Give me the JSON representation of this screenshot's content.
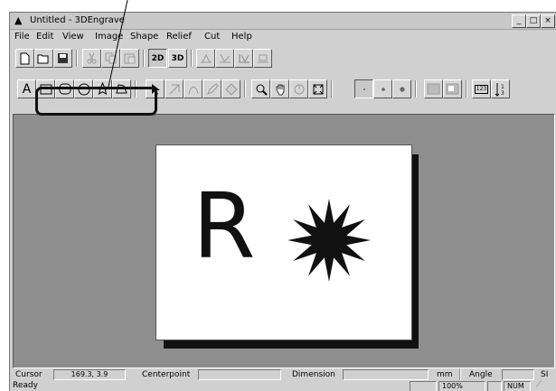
{
  "window": {
    "title": "Untitled - 3DEngrave",
    "minimize": "_",
    "maximize": "□",
    "close": "×"
  },
  "menu": [
    {
      "label": "File"
    },
    {
      "label": "Edit"
    },
    {
      "label": "View"
    },
    {
      "label": "Image"
    },
    {
      "label": "Shape"
    },
    {
      "label": "Relief"
    },
    {
      "label": "Cut"
    },
    {
      "label": "Help"
    }
  ],
  "toolbar1": {
    "view_2d": "2D",
    "view_3d": "3D"
  },
  "toolbar2": {
    "text_tool": "A",
    "counter_label": "123"
  },
  "canvas": {
    "letter": "R"
  },
  "status": {
    "cursor_label": "Cursor",
    "cursor_value": "169.3, 3.9",
    "centerpoint_label": "Centerpoint",
    "centerpoint_value": "",
    "dimension_label": "Dimension",
    "dimension_value": "",
    "unit": "mm",
    "angle_label": "Angle",
    "angle_value": "",
    "trailing": "SI",
    "ready": "Ready",
    "zoom": "100%",
    "num": "NUM"
  },
  "colors": {
    "canvas_bg": "#8e8e8e",
    "window_bg": "#d0d0d0",
    "page": "#ffffff",
    "shadow": "#111111"
  },
  "icons": [
    "new-icon",
    "open-icon",
    "save-icon",
    "cut-icon",
    "copy-icon",
    "paste-icon",
    "text-icon",
    "rectangle-icon",
    "rounded-rectangle-icon",
    "ellipse-icon",
    "star-icon",
    "polygon-icon",
    "arrow-icon",
    "zoom-icon",
    "hand-icon"
  ]
}
